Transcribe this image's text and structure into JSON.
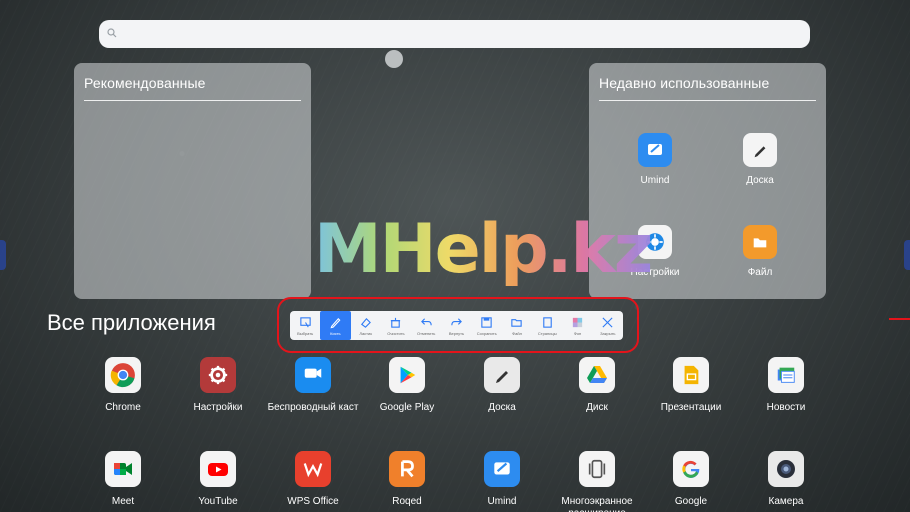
{
  "search": {
    "placeholder": ""
  },
  "panels": {
    "recommended": {
      "title": "Рекомендованные"
    },
    "recent": {
      "title": "Недавно использованные",
      "apps": [
        {
          "label": "Umind",
          "icon": "umind-icon"
        },
        {
          "label": "Доска",
          "icon": "whiteboard-icon"
        },
        {
          "label": "Настройки",
          "icon": "settings-icon"
        },
        {
          "label": "Файл",
          "icon": "folder-icon"
        }
      ]
    }
  },
  "watermark": "MHelp.kz",
  "all_apps": {
    "title": "Все приложения",
    "row1": [
      {
        "label": "Chrome",
        "icon": "chrome-icon"
      },
      {
        "label": "Настройки",
        "icon": "settings-icon"
      },
      {
        "label": "Беспроводный каст",
        "icon": "wireless-cast-icon"
      },
      {
        "label": "Google Play",
        "icon": "google-play-icon"
      },
      {
        "label": "Доска",
        "icon": "whiteboard-icon"
      },
      {
        "label": "Диск",
        "icon": "google-drive-icon"
      },
      {
        "label": "Презентации",
        "icon": "google-slides-icon"
      },
      {
        "label": "Новости",
        "icon": "google-news-icon"
      }
    ],
    "row2": [
      {
        "label": "Meet",
        "icon": "google-meet-icon"
      },
      {
        "label": "YouTube",
        "icon": "youtube-icon"
      },
      {
        "label": "WPS Office",
        "icon": "wps-office-icon"
      },
      {
        "label": "Roqed",
        "icon": "roqed-icon"
      },
      {
        "label": "Umind",
        "icon": "umind-icon"
      },
      {
        "label": "Многоэкранное расширение",
        "icon": "multiscreen-icon"
      },
      {
        "label": "Google",
        "icon": "google-icon"
      },
      {
        "label": "Камера",
        "icon": "camera-icon"
      }
    ]
  },
  "toolbar": {
    "tools": [
      {
        "label": "Выбрать",
        "icon": "select-icon"
      },
      {
        "label": "Кисть",
        "icon": "pen-icon",
        "active": true
      },
      {
        "label": "Ластик",
        "icon": "eraser-icon"
      },
      {
        "label": "Очистить",
        "icon": "clear-icon"
      },
      {
        "label": "Отменить",
        "icon": "undo-icon"
      },
      {
        "label": "Вернуть",
        "icon": "redo-icon"
      },
      {
        "label": "Сохранить",
        "icon": "save-icon"
      },
      {
        "label": "Файл",
        "icon": "folder-icon"
      },
      {
        "label": "Страницы",
        "icon": "pages-icon"
      },
      {
        "label": "Фон",
        "icon": "background-icon"
      },
      {
        "label": "Закрыть",
        "icon": "close-icon"
      }
    ]
  },
  "colors": {
    "accent": "#2f7bf5",
    "highlight": "#e3141b"
  }
}
